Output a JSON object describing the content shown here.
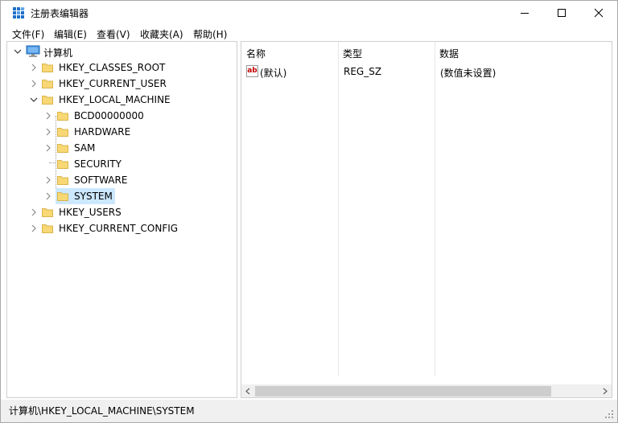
{
  "window": {
    "title": "注册表编辑器",
    "minimize_glyph": "—",
    "close_glyph": "✕"
  },
  "menu": [
    {
      "label": "文件(F)"
    },
    {
      "label": "编辑(E)"
    },
    {
      "label": "查看(V)"
    },
    {
      "label": "收藏夹(A)"
    },
    {
      "label": "帮助(H)"
    }
  ],
  "tree": {
    "root": "计算机",
    "hives": [
      {
        "label": "HKEY_CLASSES_ROOT",
        "expanded": false
      },
      {
        "label": "HKEY_CURRENT_USER",
        "expanded": false
      },
      {
        "label": "HKEY_LOCAL_MACHINE",
        "expanded": true
      },
      {
        "label": "HKEY_USERS",
        "expanded": false
      },
      {
        "label": "HKEY_CURRENT_CONFIG",
        "expanded": false
      }
    ],
    "hklm_children": [
      {
        "label": "BCD00000000",
        "has_children": true
      },
      {
        "label": "HARDWARE",
        "has_children": true
      },
      {
        "label": "SAM",
        "has_children": true
      },
      {
        "label": "SECURITY",
        "has_children": false
      },
      {
        "label": "SOFTWARE",
        "has_children": true
      },
      {
        "label": "SYSTEM",
        "has_children": true,
        "selected": true
      }
    ]
  },
  "list": {
    "columns": {
      "name": "名称",
      "type": "类型",
      "data": "数据"
    },
    "rows": [
      {
        "icon": "string-value-icon",
        "icon_text": "ab",
        "name": "(默认)",
        "type": "REG_SZ",
        "data": "(数值未设置)"
      }
    ]
  },
  "status": {
    "path": "计算机\\HKEY_LOCAL_MACHINE\\SYSTEM"
  },
  "colors": {
    "selection": "#cce8ff",
    "folder": "#f8d775",
    "accent_icon": "#1e6fc8"
  }
}
